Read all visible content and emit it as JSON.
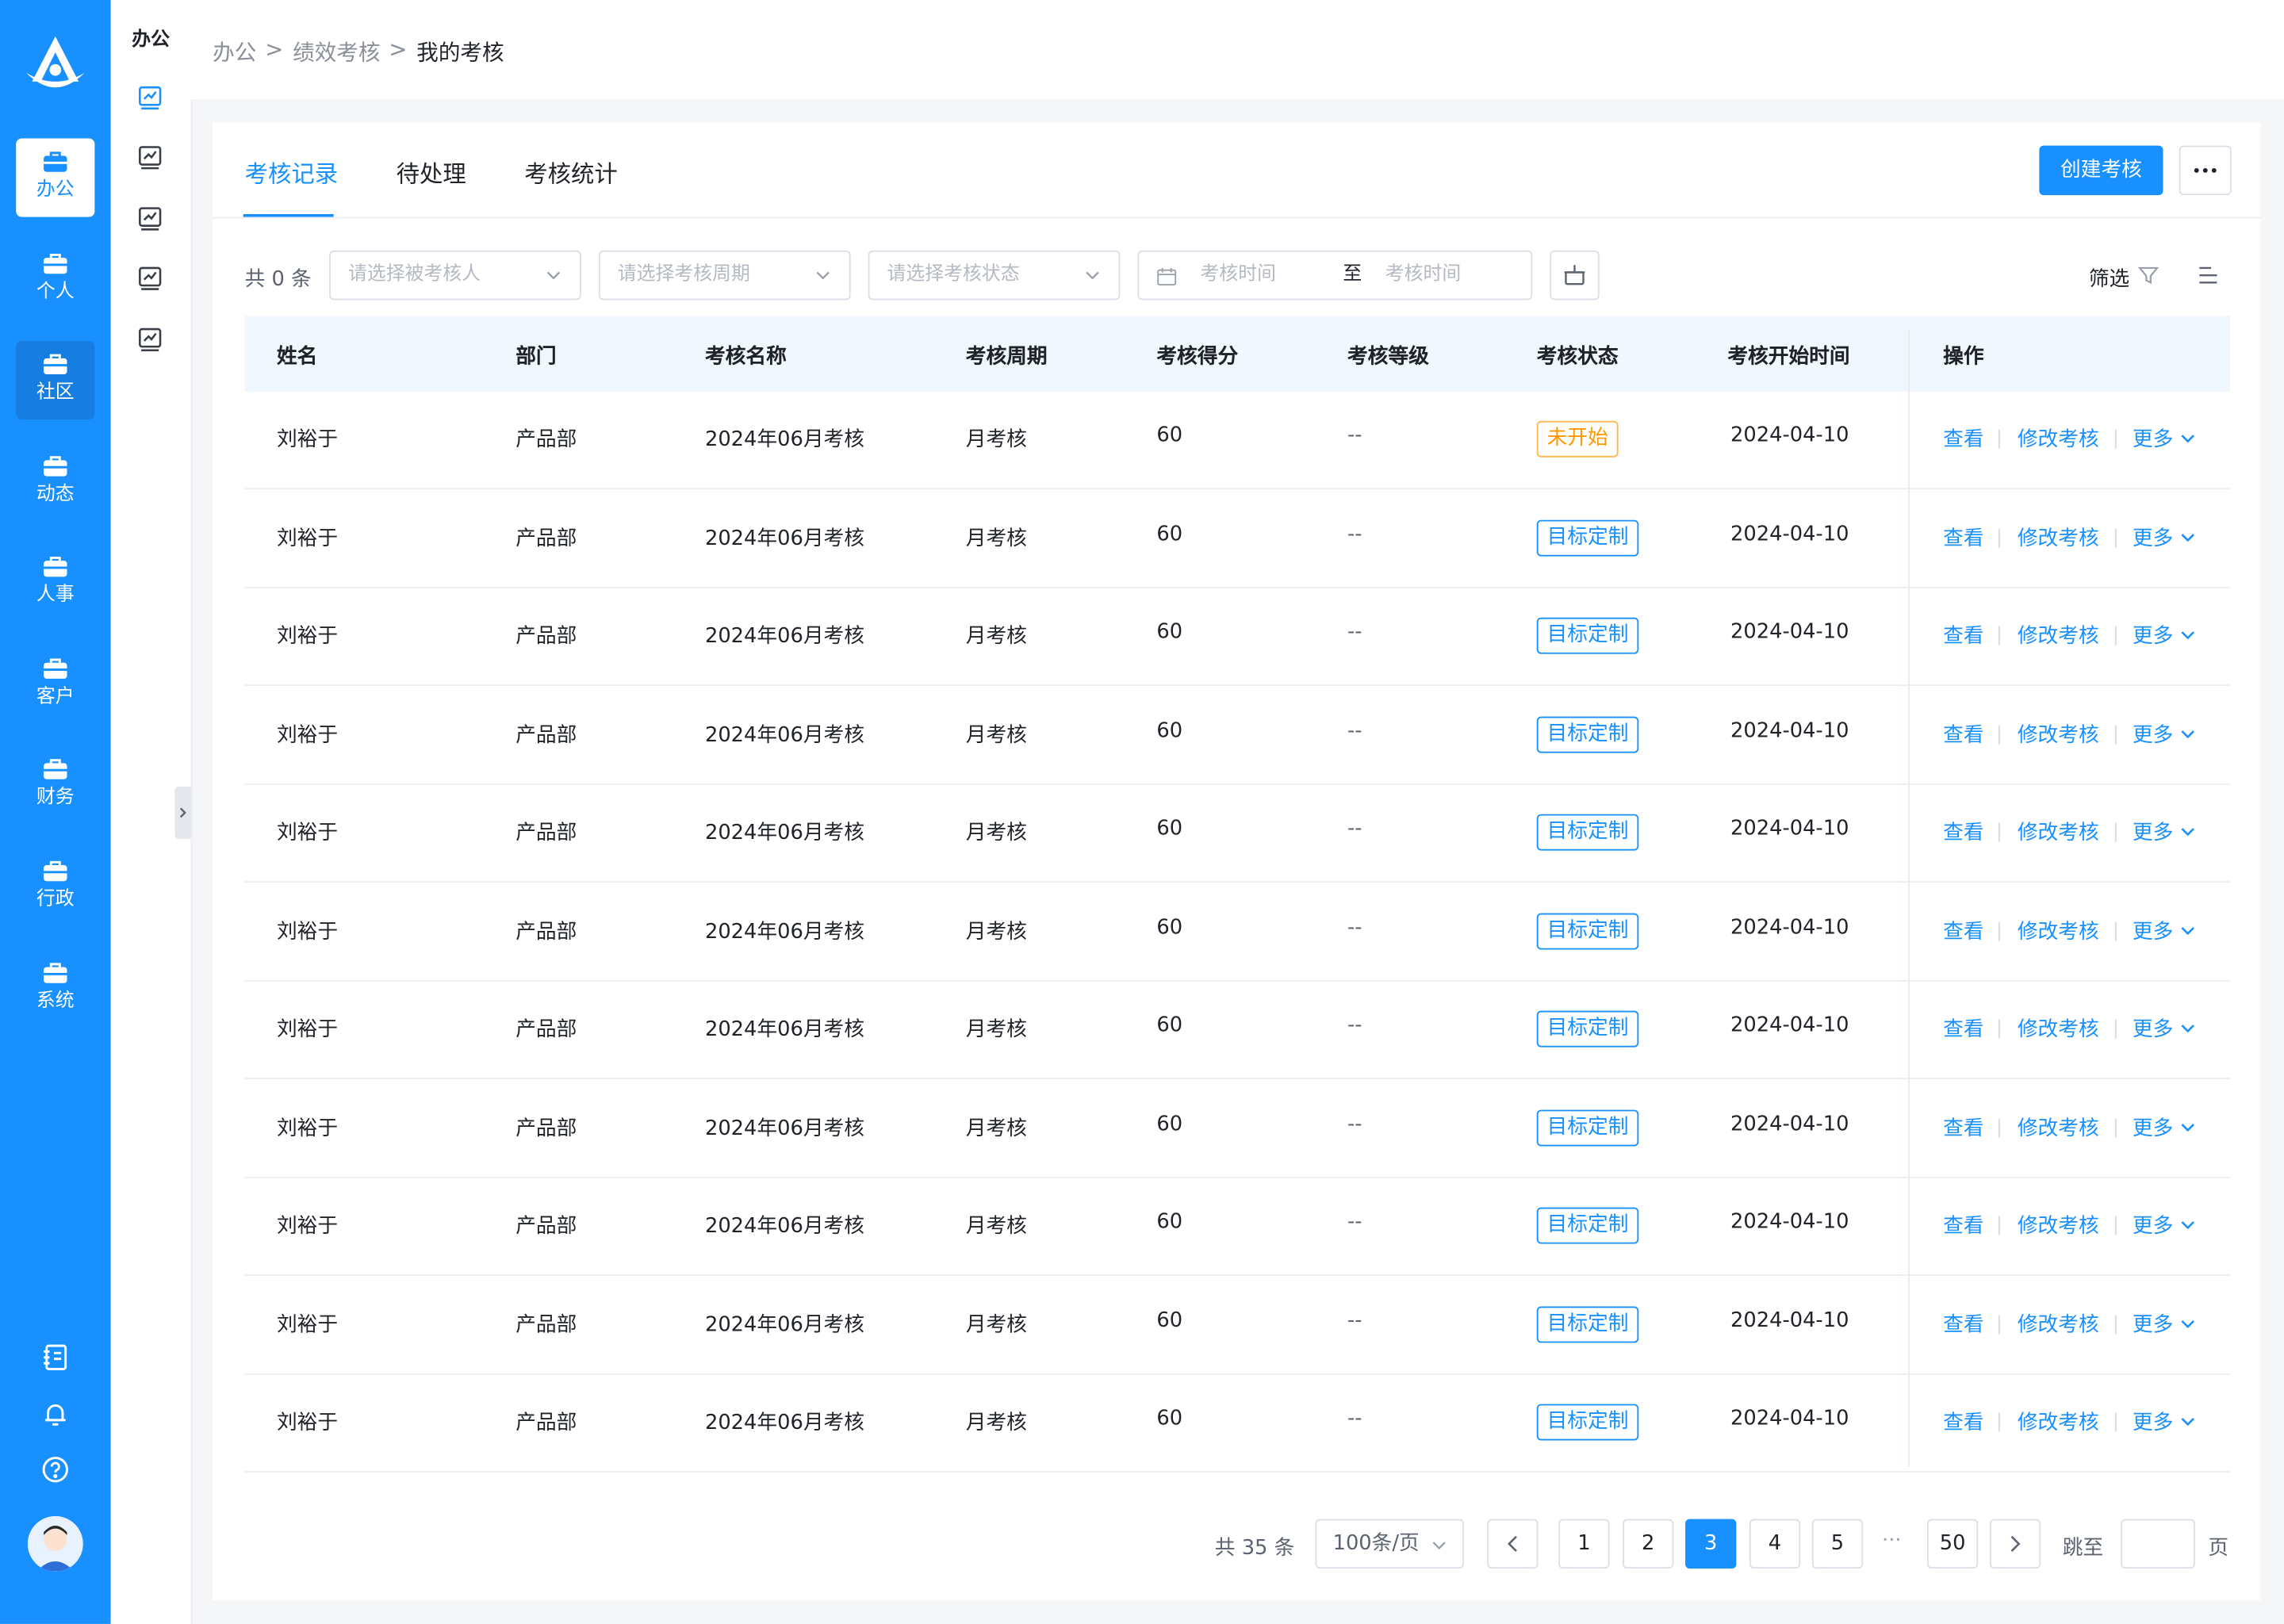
{
  "rail": {
    "items": [
      {
        "label": "办公"
      },
      {
        "label": "个人"
      },
      {
        "label": "社区"
      },
      {
        "label": "动态"
      },
      {
        "label": "人事"
      },
      {
        "label": "客户"
      },
      {
        "label": "财务"
      },
      {
        "label": "行政"
      },
      {
        "label": "系统"
      }
    ],
    "active_index": 0,
    "bottom_icons": [
      "notebook-icon",
      "bell-icon",
      "help-icon"
    ]
  },
  "sub_sidebar": {
    "title": "办公",
    "icons": [
      "chart-icon",
      "chart-icon",
      "chart-icon",
      "chart-icon",
      "chart-icon"
    ]
  },
  "breadcrumb": {
    "items": [
      "办公",
      "绩效考核",
      "我的考核"
    ],
    "separator": ">"
  },
  "tabs": [
    {
      "label": "考核记录"
    },
    {
      "label": "待处理"
    },
    {
      "label": "考核统计"
    }
  ],
  "active_tab_index": 0,
  "actions": {
    "create_label": "创建考核"
  },
  "filters": {
    "count_label": "共 0 条",
    "person_placeholder": "请选择被考核人",
    "period_placeholder": "请选择考核周期",
    "status_placeholder": "请选择考核状态",
    "date_start_placeholder": "考核时间",
    "date_to": "至",
    "date_end_placeholder": "考核时间",
    "filter_label": "筛选"
  },
  "table": {
    "columns": [
      "姓名",
      "部门",
      "考核名称",
      "考核周期",
      "考核得分",
      "考核等级",
      "考核状态",
      "考核开始时间",
      "操作"
    ],
    "rows": [
      {
        "name": "刘裕于",
        "dept": "产品部",
        "title": "2024年06月考核",
        "period": "月考核",
        "score": "60",
        "grade": "--",
        "status": "未开始",
        "status_type": "warning",
        "start": "2024-04-10"
      },
      {
        "name": "刘裕于",
        "dept": "产品部",
        "title": "2024年06月考核",
        "period": "月考核",
        "score": "60",
        "grade": "--",
        "status": "目标定制",
        "status_type": "primary",
        "start": "2024-04-10"
      },
      {
        "name": "刘裕于",
        "dept": "产品部",
        "title": "2024年06月考核",
        "period": "月考核",
        "score": "60",
        "grade": "--",
        "status": "目标定制",
        "status_type": "primary",
        "start": "2024-04-10"
      },
      {
        "name": "刘裕于",
        "dept": "产品部",
        "title": "2024年06月考核",
        "period": "月考核",
        "score": "60",
        "grade": "--",
        "status": "目标定制",
        "status_type": "primary",
        "start": "2024-04-10"
      },
      {
        "name": "刘裕于",
        "dept": "产品部",
        "title": "2024年06月考核",
        "period": "月考核",
        "score": "60",
        "grade": "--",
        "status": "目标定制",
        "status_type": "primary",
        "start": "2024-04-10"
      },
      {
        "name": "刘裕于",
        "dept": "产品部",
        "title": "2024年06月考核",
        "period": "月考核",
        "score": "60",
        "grade": "--",
        "status": "目标定制",
        "status_type": "primary",
        "start": "2024-04-10"
      },
      {
        "name": "刘裕于",
        "dept": "产品部",
        "title": "2024年06月考核",
        "period": "月考核",
        "score": "60",
        "grade": "--",
        "status": "目标定制",
        "status_type": "primary",
        "start": "2024-04-10"
      },
      {
        "name": "刘裕于",
        "dept": "产品部",
        "title": "2024年06月考核",
        "period": "月考核",
        "score": "60",
        "grade": "--",
        "status": "目标定制",
        "status_type": "primary",
        "start": "2024-04-10"
      },
      {
        "name": "刘裕于",
        "dept": "产品部",
        "title": "2024年06月考核",
        "period": "月考核",
        "score": "60",
        "grade": "--",
        "status": "目标定制",
        "status_type": "primary",
        "start": "2024-04-10"
      },
      {
        "name": "刘裕于",
        "dept": "产品部",
        "title": "2024年06月考核",
        "period": "月考核",
        "score": "60",
        "grade": "--",
        "status": "目标定制",
        "status_type": "primary",
        "start": "2024-04-10"
      },
      {
        "name": "刘裕于",
        "dept": "产品部",
        "title": "2024年06月考核",
        "period": "月考核",
        "score": "60",
        "grade": "--",
        "status": "目标定制",
        "status_type": "primary",
        "start": "2024-04-10"
      }
    ],
    "row_actions": {
      "view": "查看",
      "edit": "修改考核",
      "more": "更多"
    }
  },
  "pagination": {
    "total_label": "共 35 条",
    "page_size_label": "100条/页",
    "pages": [
      "1",
      "2",
      "3",
      "4",
      "5"
    ],
    "current_page": "3",
    "ellipsis": "···",
    "last_page": "50",
    "jump_label": "跳至",
    "page_suffix": "页"
  },
  "colors": {
    "primary": "#1890ff",
    "warning": "#ff9900",
    "header_bg": "#f1f7ff"
  }
}
